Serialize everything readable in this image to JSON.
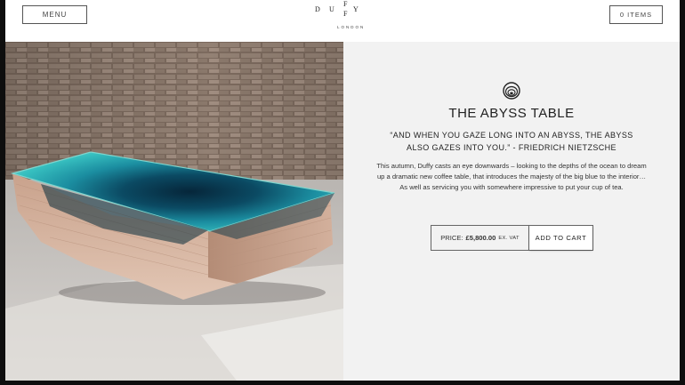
{
  "header": {
    "menu_label": "MENU",
    "cart_label": "0 ITEMS",
    "logo_letters": [
      "D",
      "U",
      "F",
      "F",
      "Y"
    ],
    "logo_sub": "LONDON"
  },
  "product": {
    "icon": "abyss-rings-icon",
    "title": "THE ABYSS TABLE",
    "quote": "“AND WHEN YOU GAZE LONG INTO AN ABYSS, THE ABYSS ALSO GAZES INTO YOU.” - FRIEDRICH NIETZSCHE",
    "description": "This autumn, Duffy casts an eye downwards – looking to the depths of the ocean to dream up a dramatic new coffee table, that introduces the majesty of the big blue to the interior… As well as servicing you with somewhere impressive to put your cup of tea.",
    "price_label": "PRICE:",
    "price_value": "£5,800.00",
    "price_vat": "EX. VAT",
    "add_to_cart_label": "ADD TO CART"
  },
  "colors": {
    "panel_bg": "#f2f2f2",
    "water_deep": "#0a3f55",
    "water_light": "#2fb7b9",
    "wood": "#d9b9a6"
  }
}
